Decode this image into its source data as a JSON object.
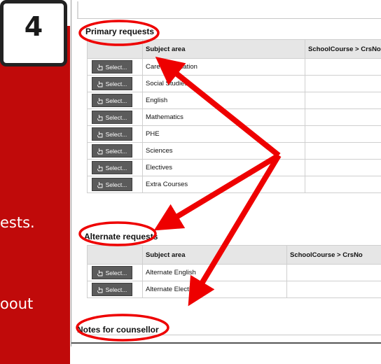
{
  "step_badge": {
    "number": "4"
  },
  "side_panel": {
    "fragments": [
      "ests.",
      "oout"
    ]
  },
  "primary": {
    "title": "Primary requests",
    "columns": [
      "",
      "Subject area",
      "SchoolCourse > CrsNo"
    ],
    "rows": [
      {
        "button": "Select...",
        "subject": "Career Education"
      },
      {
        "button": "Select...",
        "subject": "Social Studies"
      },
      {
        "button": "Select...",
        "subject": "English"
      },
      {
        "button": "Select...",
        "subject": "Mathematics"
      },
      {
        "button": "Select...",
        "subject": "PHE"
      },
      {
        "button": "Select...",
        "subject": "Sciences"
      },
      {
        "button": "Select...",
        "subject": "Electives"
      },
      {
        "button": "Select...",
        "subject": "Extra Courses"
      }
    ]
  },
  "alternate": {
    "title": "Alternate requests",
    "columns": [
      "",
      "Subject area",
      "SchoolCourse > CrsNo"
    ],
    "rows": [
      {
        "button": "Select...",
        "subject": "Alternate English"
      },
      {
        "button": "Select...",
        "subject": "Alternate Electives"
      }
    ]
  },
  "notes": {
    "title": "Notes for counsellor"
  },
  "colors": {
    "panel_red": "#c00a0a",
    "annotation_red": "#ee0000",
    "button_gray": "#5b5b5b",
    "header_gray": "#e6e6e6"
  },
  "icons": {
    "select_button": "hand-pointer-icon"
  }
}
